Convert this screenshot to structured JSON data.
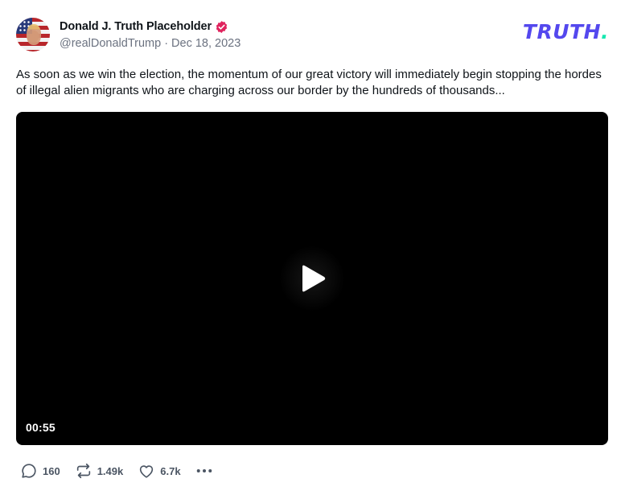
{
  "author": {
    "display_name": "Donald J. Truth Placeholder",
    "handle": "@realDonaldTrump",
    "separator": "·",
    "date": "Dec 18, 2023",
    "verified_color": "#e0245e"
  },
  "logo": {
    "text": "TRUTH",
    "dot": ".",
    "color": "#5448ee",
    "dot_color": "#17e8b0"
  },
  "post": {
    "text": "As soon as we win the election, the momentum of our great victory will immediately begin stopping the hordes of illegal alien migrants who are charging across our border by the hundreds of thousands..."
  },
  "video": {
    "duration": "00:55",
    "play_icon": "play-icon"
  },
  "actions": {
    "reply_count": "160",
    "retruth_count": "1.49k",
    "like_count": "6.7k",
    "reply_icon": "reply-icon",
    "retruth_icon": "retruth-icon",
    "like_icon": "heart-icon",
    "more_icon": "more-dots-icon"
  }
}
